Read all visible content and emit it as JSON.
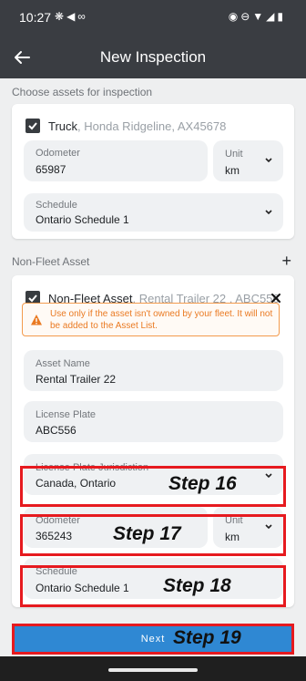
{
  "status_bar": {
    "time": "10:27",
    "left_icons": [
      "fan-icon",
      "navigation-icon",
      "voicemail-icon"
    ],
    "right_icons": [
      "location-icon",
      "do-not-disturb-icon",
      "wifi-icon",
      "signal-icon",
      "battery-icon"
    ]
  },
  "header": {
    "title": "New Inspection"
  },
  "assets_section": {
    "label": "Choose assets for inspection"
  },
  "truck_card": {
    "title": "Truck",
    "subtitle": ", Honda Ridgeline, AX45678",
    "checked": true,
    "odometer": {
      "label": "Odometer",
      "value": "65987"
    },
    "unit": {
      "label": "Unit",
      "value": "km"
    },
    "schedule": {
      "label": "Schedule",
      "value": "Ontario Schedule 1"
    }
  },
  "non_fleet_section": {
    "label": "Non-Fleet Asset",
    "add_label": "+"
  },
  "non_fleet_card": {
    "title": "Non-Fleet Asset",
    "subtitle": ", Rental Trailer 22 , ABC556",
    "checked": true,
    "warning": "Use only if the asset isn't owned by your fleet. It will not be added to the Asset List.",
    "asset_name": {
      "label": "Asset Name",
      "value": "Rental Trailer 22"
    },
    "license_plate": {
      "label": "License Plate",
      "value": "ABC556"
    },
    "jurisdiction": {
      "label": "License Plate Jurisdiction",
      "value": "Canada, Ontario"
    },
    "odometer": {
      "label": "Odometer",
      "value": "365243"
    },
    "unit": {
      "label": "Unit",
      "value": "km"
    },
    "schedule": {
      "label": "Schedule",
      "value": "Ontario Schedule 1"
    }
  },
  "steps": {
    "step16": "Step 16",
    "step17": "Step 17",
    "step18": "Step 18",
    "step19": "Step 19"
  },
  "footer": {
    "next_label": "Next"
  },
  "colors": {
    "header_bg": "#3a3d42",
    "accent": "#2f88d3",
    "warning": "#ea7a22",
    "annotation": "#e61a1f"
  }
}
